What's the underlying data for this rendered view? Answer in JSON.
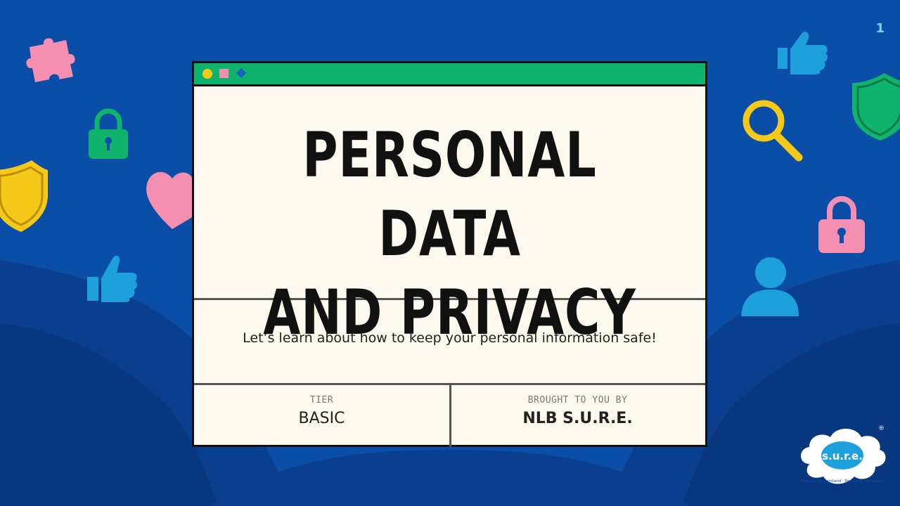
{
  "slide": {
    "page_number": "1",
    "title_line1": "PERSONAL DATA",
    "title_line2": "AND PRIVACY",
    "subtitle": "Let’s learn about how to keep your personal information safe!",
    "tier_caption": "TIER",
    "tier_value": "BASIC",
    "brought_caption": "BROUGHT TO YOU BY",
    "brought_value": "NLB S.U.R.E."
  },
  "logo": {
    "text": "s.u.r.e.",
    "tagline": "Source · Understand · Research · Evaluate",
    "registered": "®"
  },
  "decorations": [
    "puzzle-icon",
    "lock-icon",
    "shield-icon",
    "heart-icon",
    "thumbs-up-icon",
    "magnifier-icon",
    "user-icon"
  ],
  "colors": {
    "background": "#0b4ea8",
    "titlebar": "#10b36c",
    "window": "#fdf9ee",
    "pink": "#f48fb1",
    "yellow": "#f6c817",
    "green": "#10b36c",
    "light_blue": "#1ea0dc"
  }
}
